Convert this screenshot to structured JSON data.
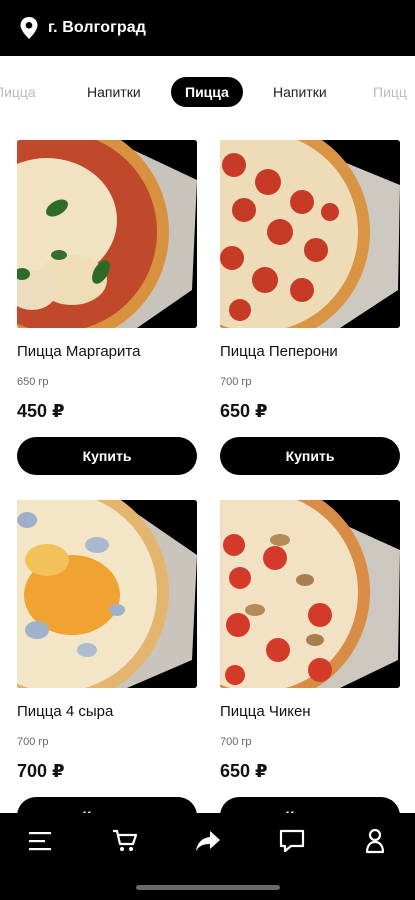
{
  "header": {
    "city": "г. Волгоград"
  },
  "tabs": [
    {
      "label": "Пицца"
    },
    {
      "label": "Напитки"
    },
    {
      "label": "Пицца"
    },
    {
      "label": "Напитки"
    },
    {
      "label": "Пицц"
    }
  ],
  "products": [
    {
      "name": "Пицца Маргарита",
      "weight": "650 гр",
      "price": "450 ₽",
      "buy_label": "Купить"
    },
    {
      "name": "Пицца Пеперони",
      "weight": "700 гр",
      "price": "650 ₽",
      "buy_label": "Купить"
    },
    {
      "name": "Пицца 4 сыра",
      "weight": "700 гр",
      "price": "700 ₽",
      "buy_label": "Купить"
    },
    {
      "name": "Пицца Чикен",
      "weight": "700 гр",
      "price": "650 ₽",
      "buy_label": "Купить"
    }
  ],
  "bottom_nav": [
    {
      "icon": "menu-icon"
    },
    {
      "icon": "cart-icon"
    },
    {
      "icon": "share-icon"
    },
    {
      "icon": "chat-icon"
    },
    {
      "icon": "profile-icon"
    }
  ],
  "colors": {
    "background": "#ffffff",
    "bars": "#000000",
    "button": "#000000"
  }
}
